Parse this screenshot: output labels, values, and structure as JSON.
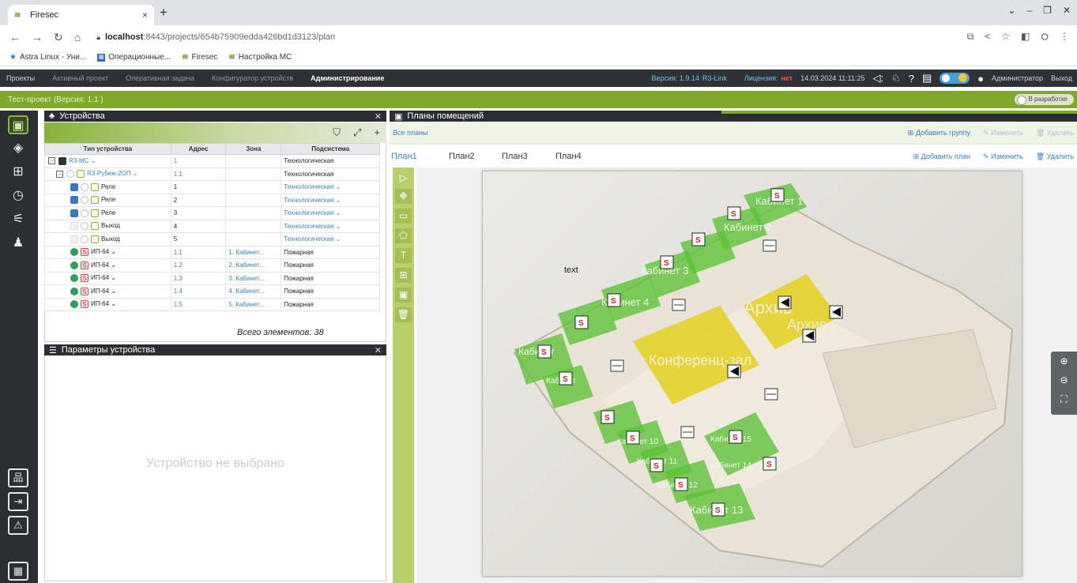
{
  "browser": {
    "tab_title": "Firesec",
    "tab_close": "×",
    "new_tab": "+",
    "url_host": "localhost",
    "url_rest": ":8443/projects/654b75909edda426bd1d3123/plan",
    "bookmarks": [
      "Astra Linux - Уни...",
      "Операционные...",
      "Firesec",
      "Настройка МС"
    ]
  },
  "app_menu": {
    "items": [
      "Проекты",
      "Активный проект",
      "Оперативная задача",
      "Конфигуратор устройств",
      "Администрирование"
    ],
    "version": "Версия: 1.9.14",
    "link": "R3-Link",
    "license_label": "Лицензия:",
    "license_value": "нет",
    "datetime": "14.03.2024 11:11:25",
    "user": "Администратор",
    "logout": "Выход"
  },
  "project_bar": {
    "title": "Тест-проект (Версия: 1.1 )",
    "badge": "В разработке"
  },
  "devices_panel": {
    "title": "Устройства",
    "columns": [
      "Тип устройства",
      "Адрес",
      "Зона",
      "Подсистема"
    ],
    "rows": [
      {
        "type": "R3-MC ⌄",
        "addr": "1",
        "zone": "",
        "sub": "Технологическая"
      },
      {
        "type": "R3-Рубеж-2ОП ⌄",
        "addr": "1.1",
        "zone": "",
        "sub": "Технологическая"
      },
      {
        "type": "Реле",
        "addr": "1",
        "zone": "",
        "sub": "Технологическая ⌄"
      },
      {
        "type": "Реле",
        "addr": "2",
        "zone": "",
        "sub": "Технологическая ⌄"
      },
      {
        "type": "Реле",
        "addr": "3",
        "zone": "",
        "sub": "Технологическая ⌄"
      },
      {
        "type": "Выход",
        "addr": "4",
        "zone": "",
        "sub": "Технологическая ⌄"
      },
      {
        "type": "Выход",
        "addr": "5",
        "zone": "",
        "sub": "Технологическая ⌄"
      },
      {
        "type": "ИП-64 ⌄",
        "addr": "1.1",
        "zone": "1. Кабинет...",
        "sub": "Пожарная"
      },
      {
        "type": "ИП-64 ⌄",
        "addr": "1.2",
        "zone": "2. Кабинет...",
        "sub": "Пожарная"
      },
      {
        "type": "ИП-64 ⌄",
        "addr": "1.3",
        "zone": "3. Кабинет...",
        "sub": "Пожарная"
      },
      {
        "type": "ИП-64 ⌄",
        "addr": "1.4",
        "zone": "4. Кабинет...",
        "sub": "Пожарная"
      },
      {
        "type": "ИП-64 ⌄",
        "addr": "1.5",
        "zone": "5. Кабинет...",
        "sub": "Пожарная"
      }
    ],
    "total": "Всего элементов: 38"
  },
  "params_panel": {
    "title": "Параметры устройства",
    "empty": "Устройство не выбрано"
  },
  "plans_panel": {
    "title": "Планы помещений",
    "all_plans": "Все планы",
    "add_group": "Добавить группу",
    "edit": "Изменить",
    "delete": "Удалить",
    "tabs": [
      "План1",
      "План2",
      "План3",
      "План4"
    ],
    "add_plan": "Добавить план"
  },
  "plan_labels": {
    "text": "text",
    "cab1": "Кабинет 1",
    "cab2": "Кабинет 2",
    "cab3": "Кабинет 3",
    "cab4": "Кабинет 4",
    "cab5": "Кабинет",
    "cab6": "Кабинет",
    "cab10": "Кабинет 10",
    "cab11": "Кабинет 11",
    "cab12": "Кабинет 12",
    "cab13": "Кабинет 13",
    "cab14": "Кабинет 14",
    "cab15": "Кабинет 15",
    "arch": "Архив",
    "arch2": "Архив-2",
    "conf": "Конференц-зал"
  },
  "colors": {
    "accent_green": "#7fa82c",
    "zone_green": "#5bc236",
    "zone_yellow": "#e3cf17",
    "dark": "#2b2f34",
    "link_blue": "#3a7fc1"
  }
}
